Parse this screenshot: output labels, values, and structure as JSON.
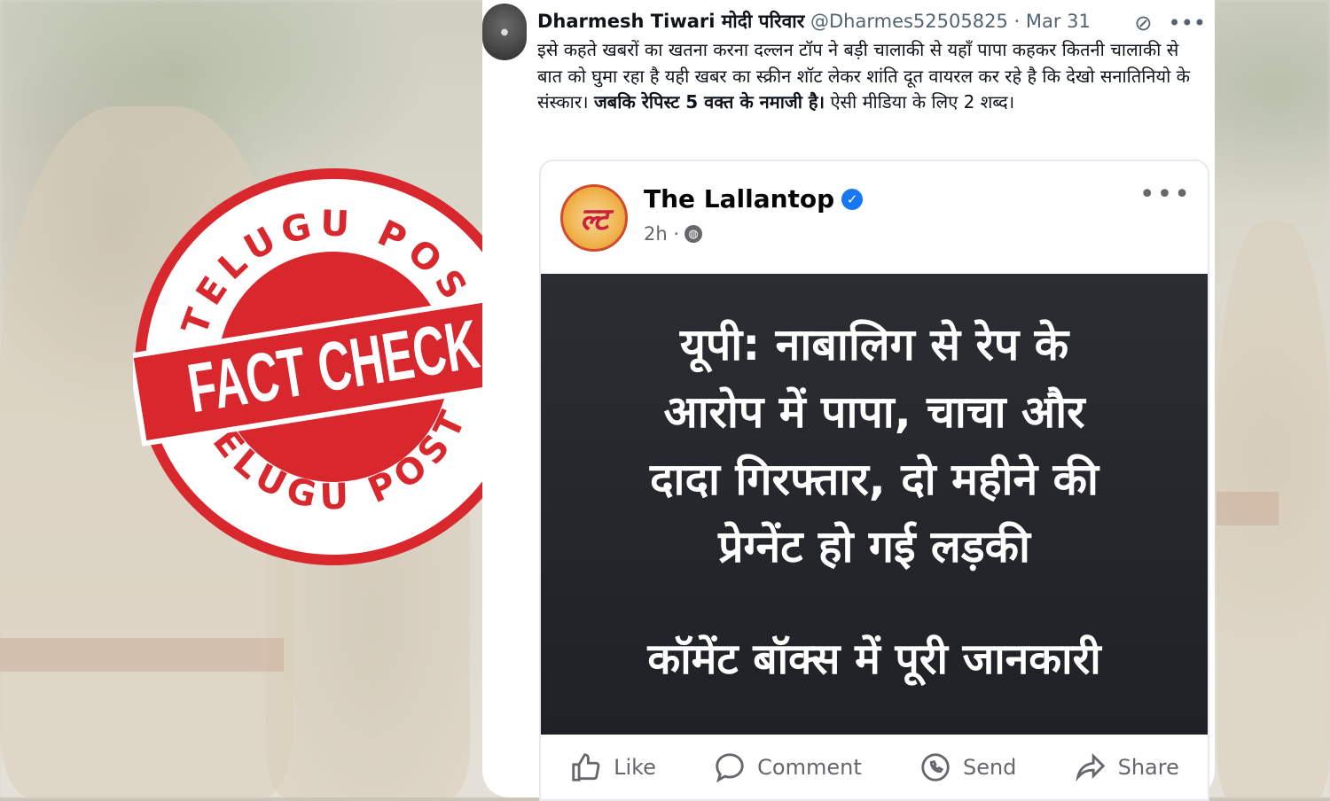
{
  "stamp": {
    "top_text": "TELUGU POST",
    "bottom_text": "TELUGU POST",
    "banner_text": "FACT CHECK",
    "color": "#d9272e"
  },
  "tweet": {
    "author_name": "Dharmesh Tiwari मोदी परिवार",
    "handle": "@Dharmes52505825",
    "separator": "·",
    "date": "Mar 31",
    "avatar_icon": "avatar-icon",
    "text_part1": "इसे कहते खबरों का खतना करना दल्लन टॉप ने बड़ी चालाकी से यहाँ पापा कहकर कितनी चालाकी से बात को घुमा रहा है यही खबर का स्क्रीन शॉट लेकर शांति दूत वायरल कर रहे है कि देखो सनातिनियो के संस्कार। ",
    "text_bold": "जबकि रेपिस्ट 5 वक्त के नमाजी है।",
    "text_part2": " ऐसी मीडिया के लिए 2 शब्द।"
  },
  "fb_post": {
    "page_name": "The Lallantop",
    "logo_text": "ल्ट",
    "time": "2h ·",
    "headline_lines": [
      "यूपी: नाबालिग से रेप के",
      "आरोप में पापा, चाचा और",
      "दादा गिरफ्तार, दो महीने की",
      "प्रेग्नेंट हो गई लड़की"
    ],
    "subline": "कॉमेंट बॉक्स में पूरी जानकारी",
    "actions": {
      "like": "Like",
      "comment": "Comment",
      "send": "Send",
      "share": "Share"
    },
    "brand_color": "#1877f2"
  }
}
